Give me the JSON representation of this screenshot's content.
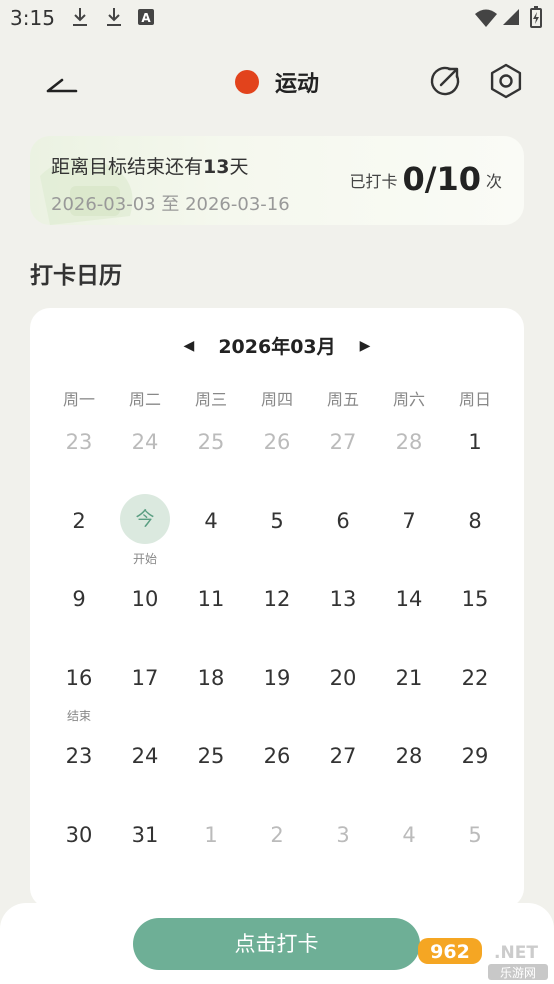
{
  "status_bar": {
    "time": "3:15",
    "left_icons": [
      "download-icon",
      "download-icon",
      "font-icon"
    ],
    "right_icons": [
      "wifi-icon",
      "signal-icon",
      "battery-icon"
    ]
  },
  "header": {
    "back_icon": "back-arrow-icon",
    "title": "运动",
    "title_dot_color": "#e2431c",
    "share_icon": "share-icon",
    "settings_icon": "gear-icon"
  },
  "goal": {
    "remaining_prefix": "距离目标结束还有",
    "remaining_days": "13",
    "remaining_suffix": "天",
    "start_date": "2026-03-03",
    "date_sep": "至",
    "end_date": "2026-03-16",
    "checked_label": "已打卡",
    "checked_count": "0/10",
    "checked_unit": "次"
  },
  "calendar": {
    "section_title": "打卡日历",
    "prev_icon": "triangle-left-icon",
    "next_icon": "triangle-right-icon",
    "month_label": "2026年03月",
    "weekdays": [
      "周一",
      "周二",
      "周三",
      "周四",
      "周五",
      "周六",
      "周日"
    ],
    "today_color": "#5a9e82",
    "weeks": [
      [
        {
          "d": "23",
          "other": true
        },
        {
          "d": "24",
          "other": true
        },
        {
          "d": "25",
          "other": true
        },
        {
          "d": "26",
          "other": true
        },
        {
          "d": "27",
          "other": true
        },
        {
          "d": "28",
          "other": true
        },
        {
          "d": "1"
        }
      ],
      [
        {
          "d": "2"
        },
        {
          "d": "今",
          "today": true,
          "note": "开始"
        },
        {
          "d": "4"
        },
        {
          "d": "5"
        },
        {
          "d": "6"
        },
        {
          "d": "7"
        },
        {
          "d": "8"
        }
      ],
      [
        {
          "d": "9"
        },
        {
          "d": "10"
        },
        {
          "d": "11"
        },
        {
          "d": "12"
        },
        {
          "d": "13"
        },
        {
          "d": "14"
        },
        {
          "d": "15"
        }
      ],
      [
        {
          "d": "16",
          "note": "结束"
        },
        {
          "d": "17"
        },
        {
          "d": "18"
        },
        {
          "d": "19"
        },
        {
          "d": "20"
        },
        {
          "d": "21"
        },
        {
          "d": "22"
        }
      ],
      [
        {
          "d": "23"
        },
        {
          "d": "24"
        },
        {
          "d": "25"
        },
        {
          "d": "26"
        },
        {
          "d": "27"
        },
        {
          "d": "28"
        },
        {
          "d": "29"
        }
      ],
      [
        {
          "d": "30"
        },
        {
          "d": "31"
        },
        {
          "d": "1",
          "other": true
        },
        {
          "d": "2",
          "other": true
        },
        {
          "d": "3",
          "other": true
        },
        {
          "d": "4",
          "other": true
        },
        {
          "d": "5",
          "other": true
        }
      ]
    ]
  },
  "checkin_button": {
    "label": "点击打卡",
    "color": "#6eaf96"
  },
  "watermark": {
    "text_top": "962.NET",
    "text_bottom": "乐游网"
  }
}
